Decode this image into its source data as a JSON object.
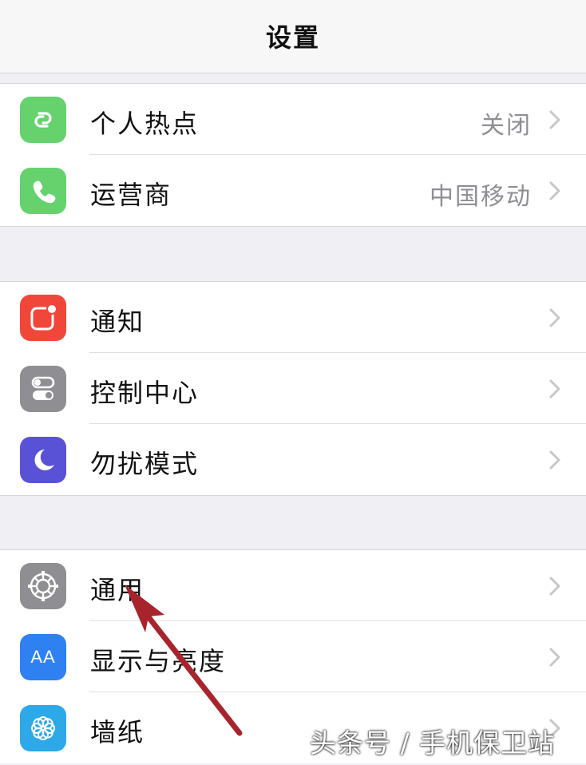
{
  "navbar": {
    "title": "设置"
  },
  "groups": [
    {
      "items": [
        {
          "label": "个人热点",
          "detail": "关闭",
          "icon": "hotspot-icon",
          "icon_color": "#65d26d"
        },
        {
          "label": "运营商",
          "detail": "中国移动",
          "icon": "phone-icon",
          "icon_color": "#65d26d"
        }
      ]
    },
    {
      "items": [
        {
          "label": "通知",
          "detail": "",
          "icon": "notifications-icon",
          "icon_color": "#f1473a"
        },
        {
          "label": "控制中心",
          "detail": "",
          "icon": "control-center-icon",
          "icon_color": "#8e8e93"
        },
        {
          "label": "勿扰模式",
          "detail": "",
          "icon": "moon-icon",
          "icon_color": "#5a52d6"
        }
      ]
    },
    {
      "items": [
        {
          "label": "通用",
          "detail": "",
          "icon": "gear-icon",
          "icon_color": "#8e8e93"
        },
        {
          "label": "显示与亮度",
          "detail": "",
          "icon": "display-brightness-icon",
          "icon_color": "#2f80f0",
          "icon_text": "AA"
        },
        {
          "label": "墙纸",
          "detail": "",
          "icon": "wallpaper-flower-icon",
          "icon_color": "#2da8e8"
        }
      ]
    }
  ],
  "annotation": {
    "arrow_color": "#a8242c"
  },
  "watermark": {
    "text": "头条号 / 手机保卫站"
  }
}
